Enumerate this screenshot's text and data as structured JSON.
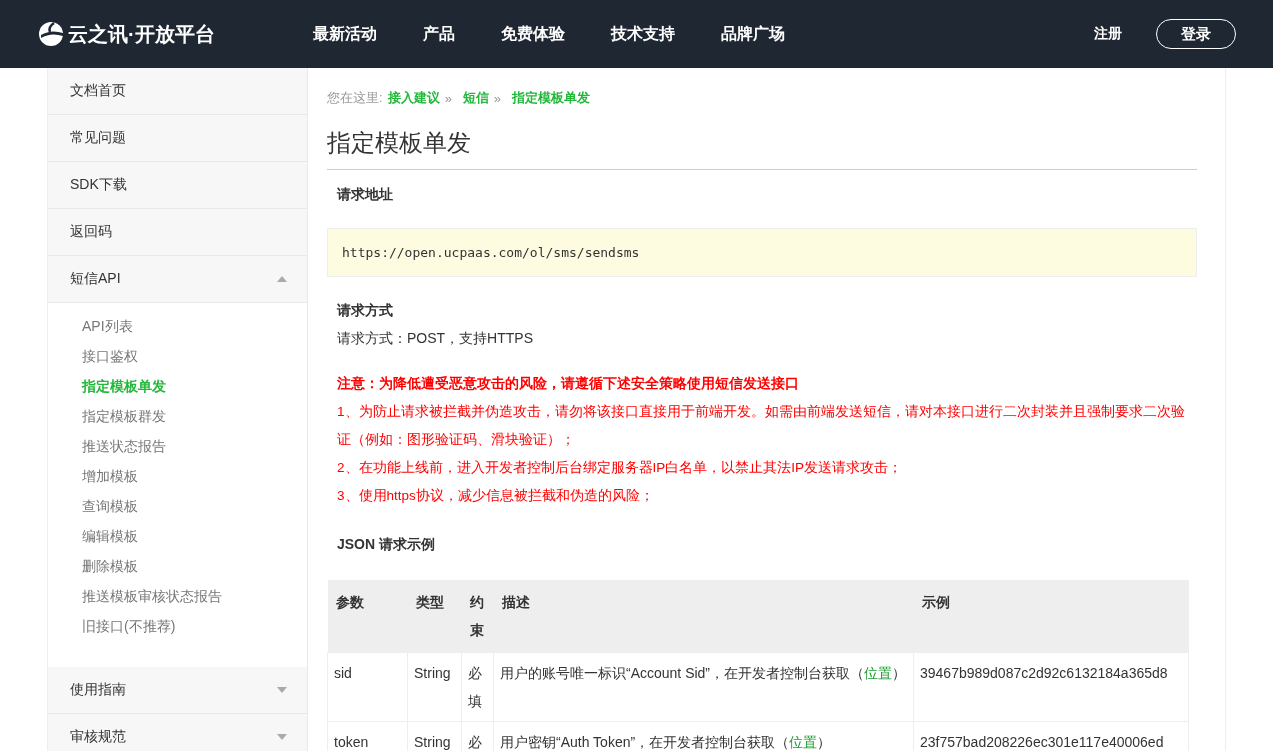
{
  "header": {
    "logo_text": "云之讯·开放平台",
    "nav": [
      "最新活动",
      "产品",
      "免费体验",
      "技术支持",
      "品牌广场"
    ],
    "register": "注册",
    "login": "登录"
  },
  "sidebar": {
    "items": [
      {
        "kind": "link",
        "label": "文档首页"
      },
      {
        "kind": "link",
        "label": "常见问题"
      },
      {
        "kind": "link",
        "label": "SDK下载"
      },
      {
        "kind": "link",
        "label": "返回码"
      },
      {
        "kind": "group",
        "label": "短信API",
        "expanded": true,
        "children": [
          {
            "label": "API列表",
            "selected": false
          },
          {
            "label": "接口鉴权",
            "selected": false
          },
          {
            "label": "指定模板单发",
            "selected": true
          },
          {
            "label": "指定模板群发",
            "selected": false
          },
          {
            "label": "推送状态报告",
            "selected": false
          },
          {
            "label": "增加模板",
            "selected": false
          },
          {
            "label": "查询模板",
            "selected": false
          },
          {
            "label": "编辑模板",
            "selected": false
          },
          {
            "label": "删除模板",
            "selected": false
          },
          {
            "label": "推送模板审核状态报告",
            "selected": false
          },
          {
            "label": "旧接口(不推荐)",
            "selected": false
          }
        ]
      },
      {
        "kind": "group",
        "label": "使用指南",
        "expanded": false
      },
      {
        "kind": "group",
        "label": "审核规范",
        "expanded": false
      }
    ]
  },
  "breadcrumb": {
    "prefix": "您在这里:",
    "links": [
      "接入建议",
      "短信"
    ],
    "separator": "»",
    "current": "指定模板单发"
  },
  "title": "指定模板单发",
  "request_url": {
    "heading": "请求地址",
    "url": "https://open.ucpaas.com/ol/sms/sendsms"
  },
  "request_method": {
    "heading": "请求方式",
    "text": "请求方式：POST，支持HTTPS"
  },
  "notice": {
    "heading": "注意：为降低遭受恶意攻击的风险，请遵循下述安全策略使用短信发送接口",
    "lines": [
      "1、为防止请求被拦截并伪造攻击，请勿将该接口直接用于前端开发。如需由前端发送短信，请对本接口进行二次封装并且强制要求二次验证（例如：图形验证码、滑块验证）；",
      "2、在功能上线前，进入开发者控制后台绑定服务器IP白名单，以禁止其法IP发送请求攻击；",
      "3、使用https协议，减少信息被拦截和伪造的风险；"
    ]
  },
  "json_example": {
    "heading": "JSON 请求示例"
  },
  "table": {
    "columns": [
      "参数",
      "类型",
      "约束",
      "描述",
      "示例"
    ],
    "rows": [
      {
        "param": "sid",
        "type": "String",
        "constraint": "必填",
        "desc_before": "用户的账号唯一标识“Account Sid”，在开发者控制台获取（",
        "link": "位置",
        "desc_after": "）",
        "example": "39467b989d087c2d92c6132184a365d8"
      },
      {
        "param": "token",
        "type": "String",
        "constraint": "必",
        "desc_before": "用户密钥“Auth Token”，在开发者控制台获取（",
        "link": "位置",
        "desc_after": "）",
        "example": "23f757bad208226ec301e117e40006ed"
      }
    ]
  }
}
